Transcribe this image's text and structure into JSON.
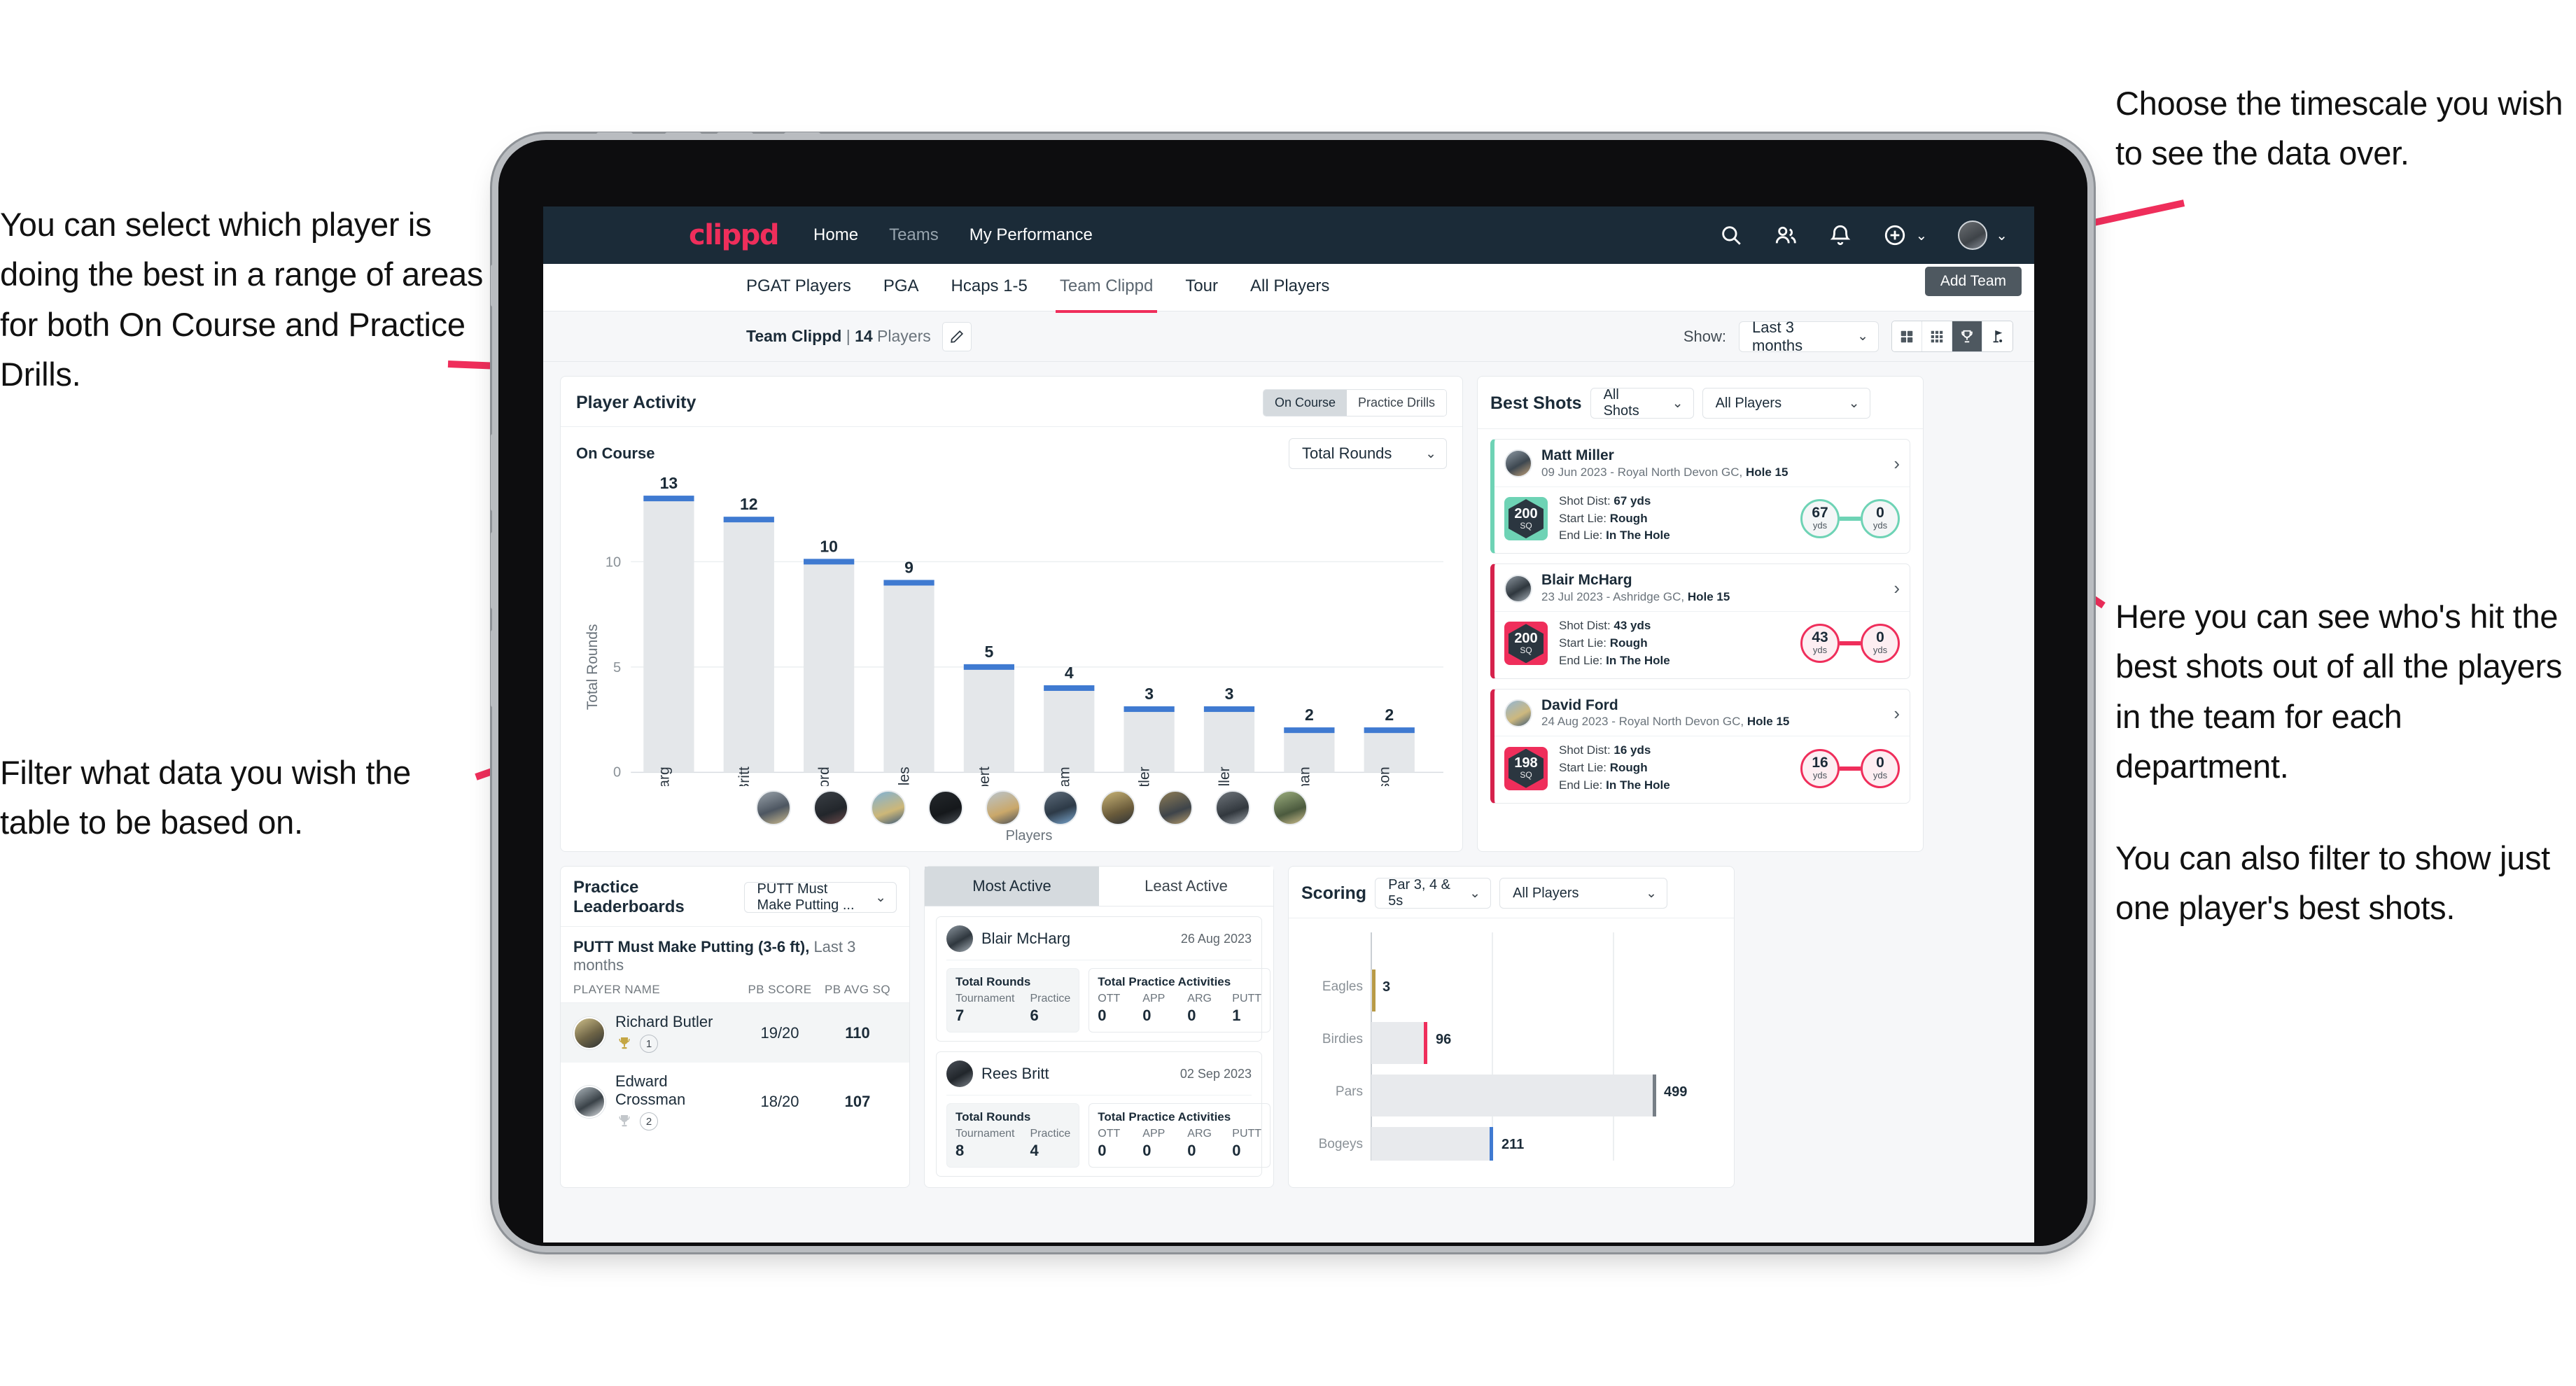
{
  "annotations": {
    "left_top": "You can select which player is doing the best in a range of areas for both On Course and Practice Drills.",
    "left_bottom": "Filter what data you wish the table to be based on.",
    "right_top": "Choose the timescale you wish to see the data over.",
    "right_mid": "Here you can see who's hit the best shots out of all the players in the team for each department.",
    "right_mid2": "You can also filter to show just one player's best shots."
  },
  "topnav": {
    "logo": "clippd",
    "links": [
      {
        "label": "Home",
        "active": true
      },
      {
        "label": "Teams",
        "active": false
      },
      {
        "label": "My Performance",
        "active": true
      }
    ],
    "icons": [
      "search-icon",
      "people-icon",
      "bell-icon",
      "plus-circle-icon",
      "avatar"
    ]
  },
  "tabs": [
    {
      "label": "PGAT Players",
      "active": false
    },
    {
      "label": "PGA",
      "active": false
    },
    {
      "label": "Hcaps 1-5",
      "active": false
    },
    {
      "label": "Team Clippd",
      "active": true
    },
    {
      "label": "Tour",
      "active": false
    },
    {
      "label": "All Players",
      "active": false
    }
  ],
  "add_team_button": "Add Team",
  "toolbar": {
    "team_name": "Team Clippd",
    "team_sep": " | ",
    "player_count": "14",
    "players_word": " Players",
    "show_label": "Show:",
    "timescale_value": "Last 3 months",
    "view_buttons": [
      "grid-large-icon",
      "grid-small-icon",
      "trophy-icon",
      "flag-icon"
    ],
    "view_active_index": 2
  },
  "player_activity": {
    "title": "Player Activity",
    "segment": [
      {
        "label": "On Course",
        "active": true
      },
      {
        "label": "Practice Drills",
        "active": false
      }
    ],
    "subtitle": "On Course",
    "metric_value": "Total Rounds",
    "chart_data": {
      "type": "bar",
      "title": "Player Activity - On Course",
      "categories": [
        "B. McHarg",
        "R. Britt",
        "D. Ford",
        "J. Coles",
        "E. Ebert",
        "D. Billingham",
        "R. Butler",
        "M. Miller",
        "E. Crossman",
        "C. Robertson"
      ],
      "values": [
        13,
        12,
        10,
        9,
        5,
        4,
        3,
        3,
        2,
        2
      ],
      "xlabel": "Players",
      "ylabel": "Total Rounds",
      "yticks": [
        0,
        5,
        10
      ],
      "ylim": [
        0,
        14
      ],
      "grid": true,
      "bar_color": "#e4e7ea",
      "cap_color": "#3f7ad1",
      "legend": "none"
    }
  },
  "best_shots": {
    "title": "Best Shots",
    "filter_shots": "All Shots",
    "filter_players": "All Players",
    "cards": [
      {
        "name": "Matt Miller",
        "meta_date": "09 Jun 2023 - Royal North Devon GC, ",
        "meta_hole": "Hole 15",
        "badge_value": "200",
        "badge_unit": "SQ",
        "badge_color": "#6ed3b5",
        "accent": "#6ed3b5",
        "shot_dist_label": "Shot Dist: ",
        "shot_dist": "67 yds",
        "start_lie_label": "Start Lie: ",
        "start_lie": "Rough",
        "end_lie_label": "End Lie: ",
        "end_lie": "In The Hole",
        "from_value": "67",
        "from_unit": "yds",
        "to_value": "0",
        "to_unit": "yds"
      },
      {
        "name": "Blair McHarg",
        "meta_date": "23 Jul 2023 - Ashridge GC, ",
        "meta_hole": "Hole 15",
        "badge_value": "200",
        "badge_unit": "SQ",
        "badge_color": "#ef2e5b",
        "accent": "#d6224c",
        "shot_dist_label": "Shot Dist: ",
        "shot_dist": "43 yds",
        "start_lie_label": "Start Lie: ",
        "start_lie": "Rough",
        "end_lie_label": "End Lie: ",
        "end_lie": "In The Hole",
        "from_value": "43",
        "from_unit": "yds",
        "to_value": "0",
        "to_unit": "yds"
      },
      {
        "name": "David Ford",
        "meta_date": "24 Aug 2023 - Royal North Devon GC, ",
        "meta_hole": "Hole 15",
        "badge_value": "198",
        "badge_unit": "SQ",
        "badge_color": "#ef2e5b",
        "accent": "#d6224c",
        "shot_dist_label": "Shot Dist: ",
        "shot_dist": "16 yds",
        "start_lie_label": "Start Lie: ",
        "start_lie": "Rough",
        "end_lie_label": "End Lie: ",
        "end_lie": "In The Hole",
        "from_value": "16",
        "from_unit": "yds",
        "to_value": "0",
        "to_unit": "yds"
      }
    ]
  },
  "practice_leaderboards": {
    "title": "Practice Leaderboards",
    "drill_select": "PUTT Must Make Putting ...",
    "subtitle_bold": "PUTT Must Make Putting (3-6 ft),",
    "subtitle_dim": " Last 3 months",
    "columns": [
      "PLAYER NAME",
      "PB SCORE",
      "PB AVG SQ"
    ],
    "rows": [
      {
        "name": "Richard Butler",
        "rank": "1",
        "trophy": "gold",
        "pb_score": "19/20",
        "pb_avg_sq": "110"
      },
      {
        "name": "Edward Crossman",
        "rank": "2",
        "trophy": "silver",
        "pb_score": "18/20",
        "pb_avg_sq": "107"
      }
    ]
  },
  "activity_panel": {
    "tabs": [
      {
        "label": "Most Active",
        "active": true
      },
      {
        "label": "Least Active",
        "active": false
      }
    ],
    "cards": [
      {
        "name": "Blair McHarg",
        "date": "26 Aug 2023",
        "rounds_title": "Total Rounds",
        "rounds": [
          {
            "key": "Tournament",
            "value": "7"
          },
          {
            "key": "Practice",
            "value": "6"
          }
        ],
        "practice_title": "Total Practice Activities",
        "practice": [
          {
            "key": "OTT",
            "value": "0"
          },
          {
            "key": "APP",
            "value": "0"
          },
          {
            "key": "ARG",
            "value": "0"
          },
          {
            "key": "PUTT",
            "value": "1"
          }
        ]
      },
      {
        "name": "Rees Britt",
        "date": "02 Sep 2023",
        "rounds_title": "Total Rounds",
        "rounds": [
          {
            "key": "Tournament",
            "value": "8"
          },
          {
            "key": "Practice",
            "value": "4"
          }
        ],
        "practice_title": "Total Practice Activities",
        "practice": [
          {
            "key": "OTT",
            "value": "0"
          },
          {
            "key": "APP",
            "value": "0"
          },
          {
            "key": "ARG",
            "value": "0"
          },
          {
            "key": "PUTT",
            "value": "0"
          }
        ]
      }
    ]
  },
  "scoring": {
    "title": "Scoring",
    "filter_par": "Par 3, 4 & 5s",
    "filter_players": "All Players",
    "chart_data": {
      "type": "bar",
      "orientation": "horizontal",
      "title": "Scoring",
      "categories": [
        "Eagles",
        "Birdies",
        "Pars",
        "Bogeys"
      ],
      "values": [
        3,
        96,
        499,
        211
      ],
      "colors": [
        "#b89a46",
        "#ef2e5b",
        "#767e86",
        "#3f7ad1"
      ],
      "xlim": [
        0,
        620
      ],
      "grid": true,
      "xlabel": "",
      "ylabel": ""
    }
  }
}
